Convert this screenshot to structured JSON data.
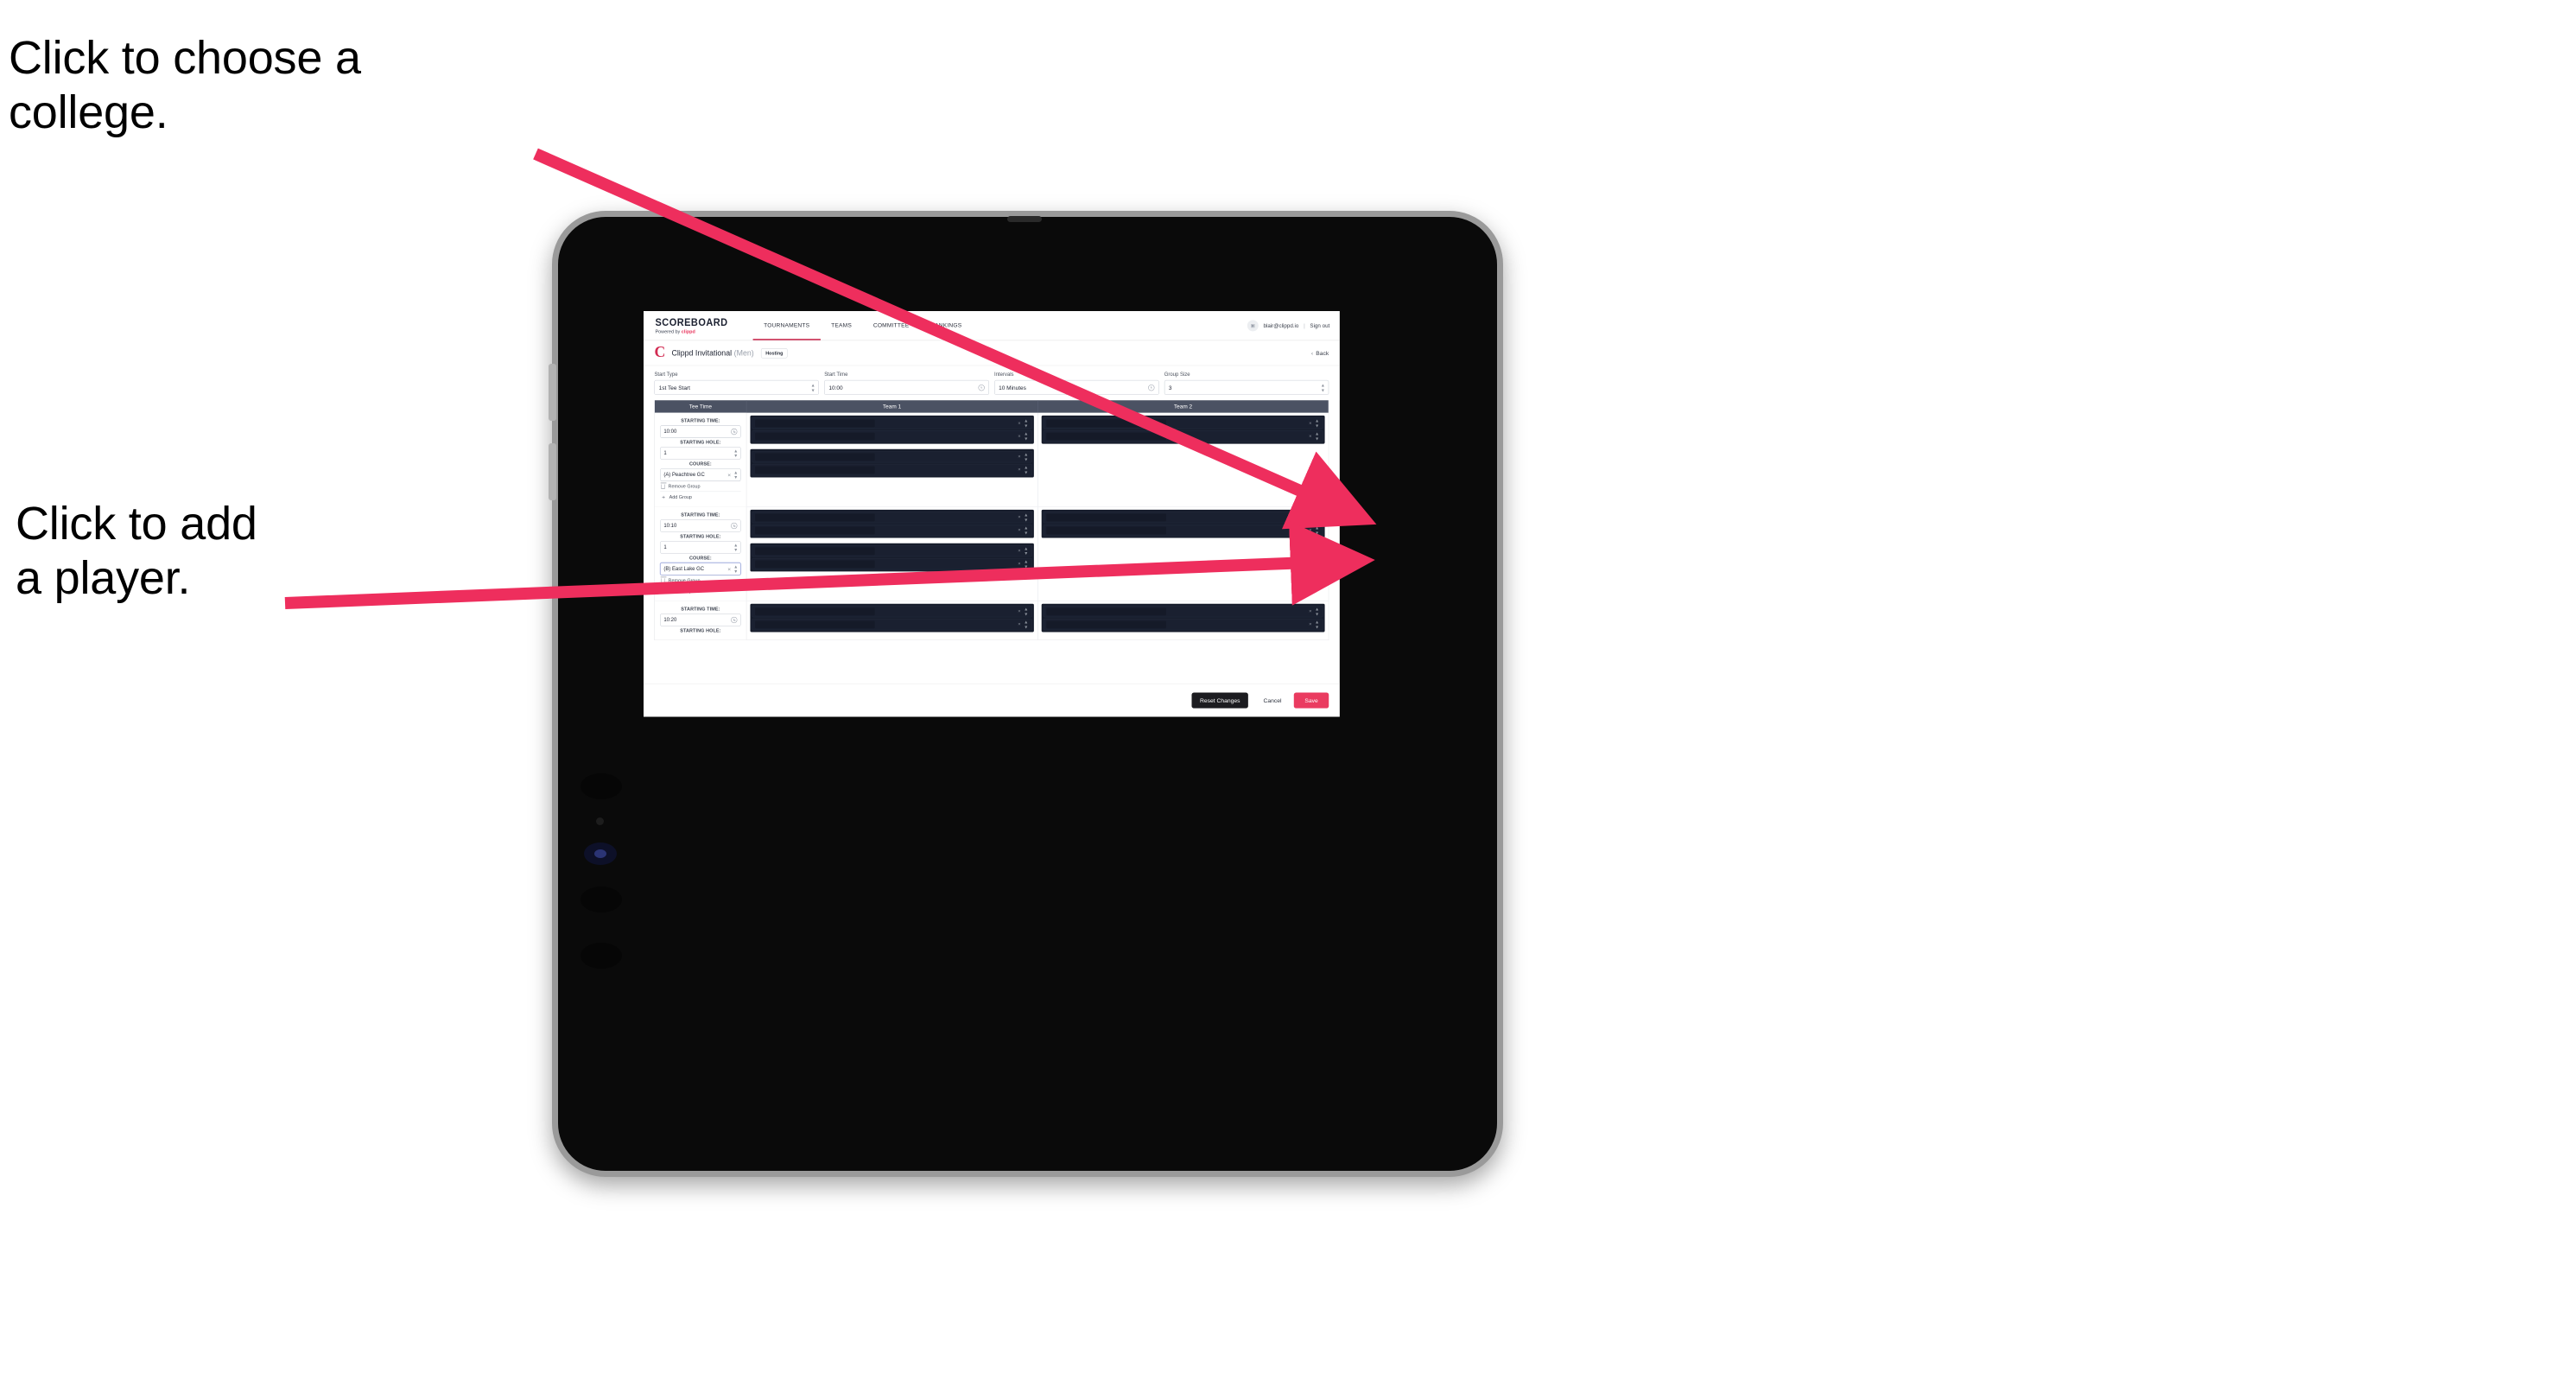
{
  "annotations": {
    "choose_college": "Click to choose a\ncollege.",
    "add_player": "Click to add\na player.",
    "arrow_color": "#ee2e5d"
  },
  "app": {
    "topnav": {
      "logo_word": "SCOREBOARD",
      "logo_sub_prefix": "Powered by ",
      "logo_sub_brand": "clippd",
      "items": [
        {
          "label": "TOURNAMENTS",
          "active": true
        },
        {
          "label": "TEAMS",
          "active": false
        },
        {
          "label": "COMMITTEE",
          "active": false
        },
        {
          "label": "RANKINGS",
          "active": false
        }
      ],
      "avatar_icon": "user-avatar-icon",
      "user_email": "blair@clippd.io",
      "separator": "|",
      "sign_out": "Sign out"
    },
    "titlebar": {
      "brand_mark": "C",
      "tournament_name": "Clippd Invitational",
      "gender": "(Men)",
      "role_chip": "Hosting",
      "back_chevron": "‹",
      "back_label": "Back"
    },
    "controls": [
      {
        "label": "Start Type",
        "value": "1st Tee Start",
        "icon": "stepper-icon"
      },
      {
        "label": "Start Time",
        "value": "10:00",
        "icon": "clock-icon"
      },
      {
        "label": "Intervals",
        "value": "10 Minutes",
        "icon": "clock-icon"
      },
      {
        "label": "Group Size",
        "value": "3",
        "icon": "stepper-icon"
      }
    ],
    "table": {
      "headers": [
        "Tee Time",
        "Team 1",
        "Team 2"
      ],
      "field_labels": {
        "starting_time": "STARTING TIME:",
        "starting_hole": "STARTING HOLE:",
        "course": "COURSE:"
      },
      "group_actions": {
        "remove": "Remove Group",
        "add": "Add Group"
      },
      "rows": [
        {
          "starting_time": "10:00",
          "starting_hole": "1",
          "course": "(A) Peachtree GC",
          "course_focused": false,
          "team1_groups": [
            2,
            2
          ],
          "team2_groups": [
            2
          ]
        },
        {
          "starting_time": "10:10",
          "starting_hole": "1",
          "course": "(B) East Lake GC",
          "course_focused": true,
          "team1_groups": [
            2,
            2
          ],
          "team2_groups": [
            2
          ]
        },
        {
          "starting_time": "10:20",
          "starting_hole": "",
          "course": "",
          "course_focused": false,
          "team1_groups": [
            2
          ],
          "team2_groups": [
            2
          ]
        }
      ],
      "row_icons": {
        "clear": "×",
        "stepper_up": "⌃",
        "stepper_down": "⌄"
      }
    },
    "footer": {
      "reset": "Reset Changes",
      "cancel": "Cancel",
      "save": "Save"
    },
    "colors": {
      "accent_pink": "#ea3b60",
      "header_slate": "#4b5263",
      "dark_row": "#1a2030"
    }
  }
}
